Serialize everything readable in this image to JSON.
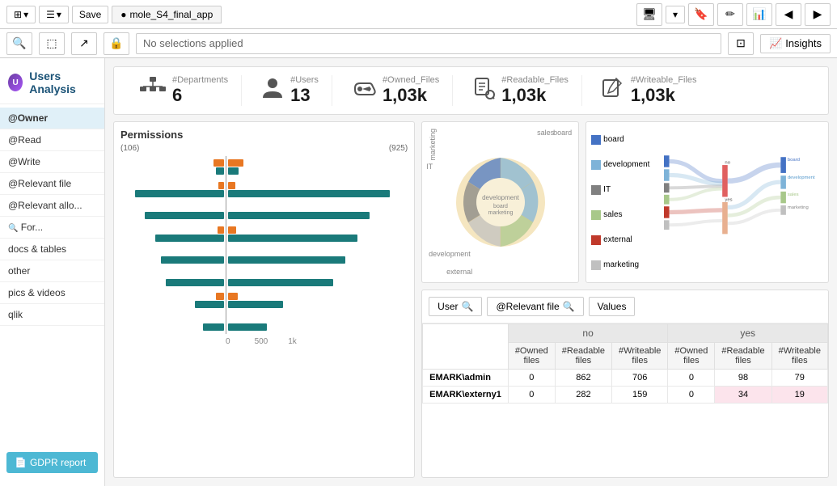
{
  "toolbar": {
    "save_label": "Save",
    "app_name": "mole_S4_final_app",
    "nav_back": "◀",
    "nav_forward": "▶"
  },
  "second_toolbar": {
    "no_selections": "No selections applied",
    "insights_label": "Insights"
  },
  "app": {
    "title": "Users Analysis"
  },
  "sidebar": {
    "items": [
      {
        "label": "@Owner",
        "active": true
      },
      {
        "label": "@Read",
        "active": false
      },
      {
        "label": "@Write",
        "active": false
      },
      {
        "label": "@Relevant file",
        "active": false
      },
      {
        "label": "@Relevant allo...",
        "active": false
      },
      {
        "label": "For...",
        "active": false
      },
      {
        "label": "docs & tables",
        "active": false
      },
      {
        "label": "other",
        "active": false
      },
      {
        "label": "pics & videos",
        "active": false
      },
      {
        "label": "qlik",
        "active": false
      }
    ],
    "gdpr_label": "GDPR report"
  },
  "kpis": [
    {
      "label": "#Departments",
      "value": "6",
      "icon": "🏢"
    },
    {
      "label": "#Users",
      "value": "13",
      "icon": "👤"
    },
    {
      "label": "#Owned_Files",
      "value": "1,03k",
      "icon": "🔑"
    },
    {
      "label": "#Readable_Files",
      "value": "1,03k",
      "icon": "📋"
    },
    {
      "label": "#Writeable_Files",
      "value": "1,03k",
      "icon": "📝"
    }
  ],
  "permissions_chart": {
    "title": "Permissions",
    "left_label": "(106)",
    "right_label": "(925)",
    "x_labels": [
      "0",
      "500",
      "1k"
    ],
    "rows": [
      {
        "teal": 0.1,
        "orange": 0.15
      },
      {
        "teal": 0.85,
        "orange": 0.07
      },
      {
        "teal": 0.75,
        "orange": 0.0
      },
      {
        "teal": 0.65,
        "orange": 0.08
      },
      {
        "teal": 0.6,
        "orange": 0.0
      },
      {
        "teal": 0.55,
        "orange": 0.0
      },
      {
        "teal": 0.28,
        "orange": 0.1
      },
      {
        "teal": 0.2,
        "orange": 0.0
      }
    ]
  },
  "sankey": {
    "left_labels": [
      "board",
      "development",
      "IT",
      "sales",
      "external",
      "marketing"
    ],
    "right_labels": [
      "board",
      "development",
      "sales",
      "marketing"
    ],
    "mid_labels": [
      "no",
      "yes"
    ],
    "colors": {
      "board": "#4472C4",
      "development": "#7eb3d8",
      "IT": "#808080",
      "sales": "#a8c88a",
      "external": "#c0392b",
      "marketing": "#c0c0c0"
    }
  },
  "table": {
    "search_user": "User",
    "search_file": "@Relevant file",
    "values_btn": "Values",
    "group_no": "no",
    "group_yes": "yes",
    "col_owned": "#Owned files",
    "col_readable": "#Readable files",
    "col_writeable": "#Writeable files",
    "rows": [
      {
        "user": "EMARK\\admin",
        "no_owned": "0",
        "no_readable": "862",
        "no_writeable": "706",
        "yes_owned": "0",
        "yes_readable": "98",
        "yes_writeable": "79",
        "highlight_readable": false,
        "highlight_writeable": false
      },
      {
        "user": "EMARK\\externy1",
        "no_owned": "0",
        "no_readable": "282",
        "no_writeable": "159",
        "yes_owned": "0",
        "yes_readable": "34",
        "yes_writeable": "19",
        "highlight_readable": true,
        "highlight_writeable": true
      }
    ]
  },
  "donut": {
    "segments": [
      {
        "label": "marketing",
        "color": "#c0c0c0",
        "angle": 40
      },
      {
        "label": "sales",
        "color": "#a8c88a",
        "angle": 30
      },
      {
        "label": "IT",
        "color": "#808080",
        "angle": 25
      },
      {
        "label": "board",
        "color": "#4472C4",
        "angle": 35
      },
      {
        "label": "development",
        "color": "#7eb3d8",
        "angle": 45
      },
      {
        "label": "external",
        "color": "#e8cfa0",
        "angle": 50
      },
      {
        "label": "center",
        "color": "#f5e6c0",
        "angle": 360
      }
    ]
  }
}
